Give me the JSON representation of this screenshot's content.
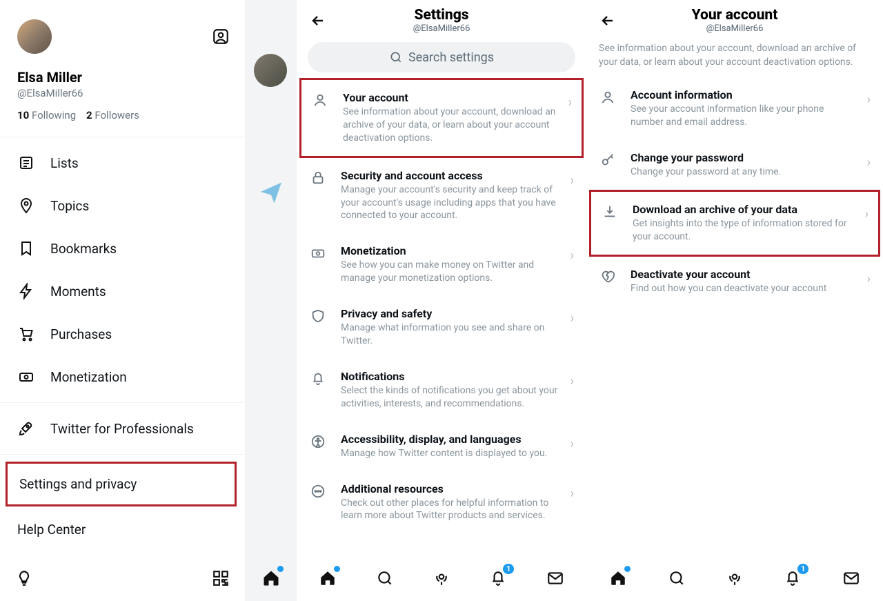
{
  "profile": {
    "name": "Elsa Miller",
    "handle": "@ElsaMiller66",
    "following_count": "10",
    "following_label": "Following",
    "followers_count": "2",
    "followers_label": "Followers"
  },
  "sidebar": {
    "items": [
      {
        "label": "Lists"
      },
      {
        "label": "Topics"
      },
      {
        "label": "Bookmarks"
      },
      {
        "label": "Moments"
      },
      {
        "label": "Purchases"
      },
      {
        "label": "Monetization"
      }
    ],
    "professionals_label": "Twitter for Professionals",
    "settings_privacy_label": "Settings and privacy",
    "help_center_label": "Help Center"
  },
  "settings": {
    "title": "Settings",
    "handle": "@ElsaMiller66",
    "search_placeholder": "Search settings",
    "items": [
      {
        "title": "Your account",
        "desc": "See information about your account, download an archive of your data, or learn about your account deactivation options."
      },
      {
        "title": "Security and account access",
        "desc": "Manage your account's security and keep track of your account's usage including apps that you have connected to your account."
      },
      {
        "title": "Monetization",
        "desc": "See how you can make money on Twitter and manage your monetization options."
      },
      {
        "title": "Privacy and safety",
        "desc": "Manage what information you see and share on Twitter."
      },
      {
        "title": "Notifications",
        "desc": "Select the kinds of notifications you get about your activities, interests, and recommendations."
      },
      {
        "title": "Accessibility, display, and languages",
        "desc": "Manage how Twitter content is displayed to you."
      },
      {
        "title": "Additional resources",
        "desc": "Check out other places for helpful information to learn more about Twitter products and services."
      }
    ]
  },
  "account": {
    "title": "Your account",
    "handle": "@ElsaMiller66",
    "intro": "See information about your account, download an archive of your data, or learn about your account deactivation options.",
    "items": [
      {
        "title": "Account information",
        "desc": "See your account information like your phone number and email address."
      },
      {
        "title": "Change your password",
        "desc": "Change your password at any time."
      },
      {
        "title": "Download an archive of your data",
        "desc": "Get insights into the type of information stored for your account."
      },
      {
        "title": "Deactivate your account",
        "desc": "Find out how you can deactivate your account"
      }
    ]
  },
  "bottomnav": {
    "bell_badge": "1"
  }
}
